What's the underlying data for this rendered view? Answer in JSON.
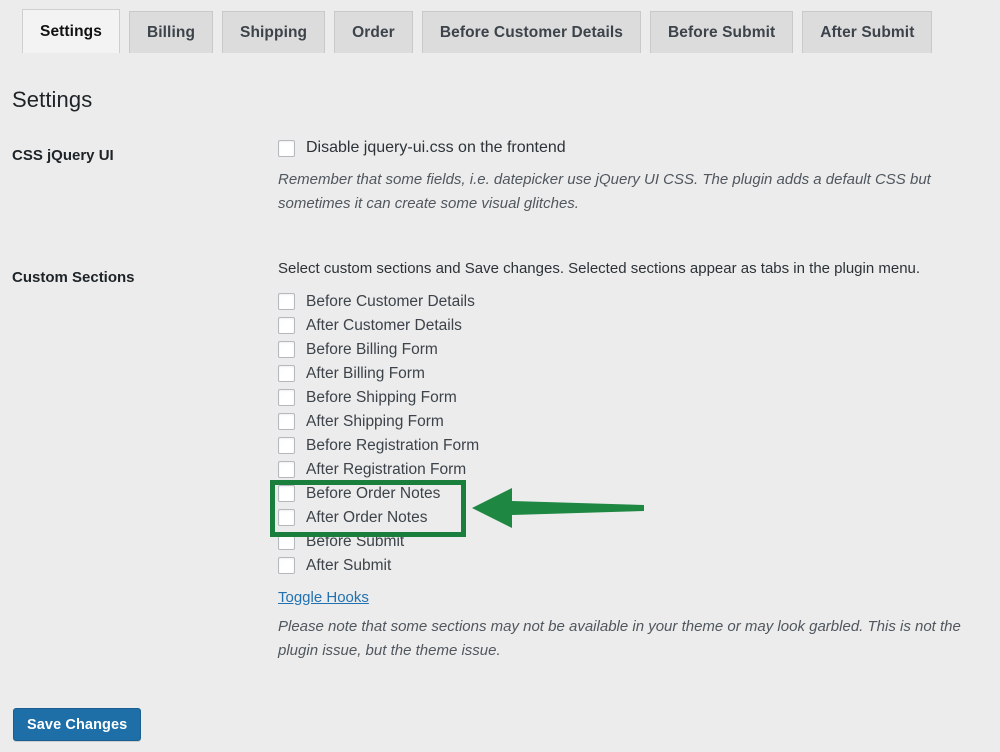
{
  "tabs": [
    {
      "label": "Settings",
      "active": true
    },
    {
      "label": "Billing",
      "active": false
    },
    {
      "label": "Shipping",
      "active": false
    },
    {
      "label": "Order",
      "active": false
    },
    {
      "label": "Before Customer Details",
      "active": false
    },
    {
      "label": "Before Submit",
      "active": false
    },
    {
      "label": "After Submit",
      "active": false
    }
  ],
  "page": {
    "title": "Settings"
  },
  "css_jquery_ui": {
    "label": "CSS jQuery UI",
    "checkbox_label": "Disable jquery-ui.css on the frontend",
    "checked": false,
    "description": "Remember that some fields, i.e. datepicker use jQuery UI CSS. The plugin adds a default CSS but sometimes it can create some visual glitches."
  },
  "custom_sections": {
    "label": "Custom Sections",
    "lead": "Select custom sections and Save changes. Selected sections appear as tabs in the plugin menu.",
    "options": [
      {
        "label": "Before Customer Details",
        "checked": false
      },
      {
        "label": "After Customer Details",
        "checked": false
      },
      {
        "label": "Before Billing Form",
        "checked": false
      },
      {
        "label": "After Billing Form",
        "checked": false
      },
      {
        "label": "Before Shipping Form",
        "checked": false
      },
      {
        "label": "After Shipping Form",
        "checked": false
      },
      {
        "label": "Before Registration Form",
        "checked": false
      },
      {
        "label": "After Registration Form",
        "checked": false
      },
      {
        "label": "Before Order Notes",
        "checked": false
      },
      {
        "label": "After Order Notes",
        "checked": false
      },
      {
        "label": "Before Submit",
        "checked": false
      },
      {
        "label": "After Submit",
        "checked": false
      }
    ],
    "toggle_hooks_label": "Toggle Hooks",
    "note": "Please note that some sections may not be available in your theme or may look garbled. This is not the plugin issue, but the theme issue."
  },
  "footer": {
    "save_label": "Save Changes"
  },
  "annotation": {
    "highlight_color": "#1a7f3c",
    "arrow_color": "#1e8742",
    "highlights": [
      "Before Order Notes",
      "After Order Notes"
    ]
  },
  "colors": {
    "page_background": "#ececec",
    "tab_inactive": "#dcdcdc",
    "tab_active": "#f3f3f3",
    "link": "#2271b1",
    "primary_button": "#1e6fa8"
  }
}
